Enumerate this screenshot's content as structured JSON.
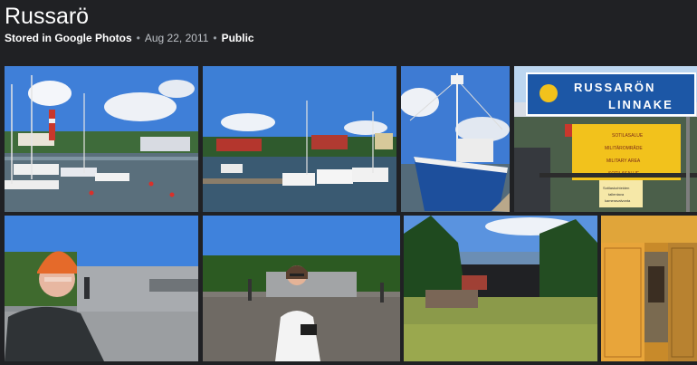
{
  "album": {
    "title": "Russarö",
    "stored_in": "Stored in Google Photos",
    "date": "Aug 22, 2011",
    "visibility": "Public"
  },
  "photos": [
    {
      "subject": "harbor with lighthouse and moored boats"
    },
    {
      "subject": "marina with white motorboats and red houses"
    },
    {
      "subject": "blue fishing boat at dock"
    },
    {
      "subject": "Russarö Linnake sign and warning notice"
    },
    {
      "subject": "man in orange cap by bunker"
    },
    {
      "subject": "woman in white jacket on concrete fortification"
    },
    {
      "subject": "green island landscape with ruin and sea"
    },
    {
      "subject": "open yellow wooden doors"
    }
  ],
  "sign": {
    "line1": "RUSSARÖN",
    "line2": "LINNAKE",
    "warning_lines": [
      "SOTILASALUE",
      "MILITÄROMRÅDE",
      "MILITARY AREA",
      "SOTILASALUE"
    ],
    "small_text": [
      "Sotilaskohteiden",
      "tallentava",
      "kameravalvonta"
    ]
  },
  "colors": {
    "background": "#202124",
    "sky": "#4a86d6",
    "sign_blue": "#1c57a6",
    "sign_yellow": "#f2c21c",
    "boat_blue": "#1d4f9c"
  }
}
